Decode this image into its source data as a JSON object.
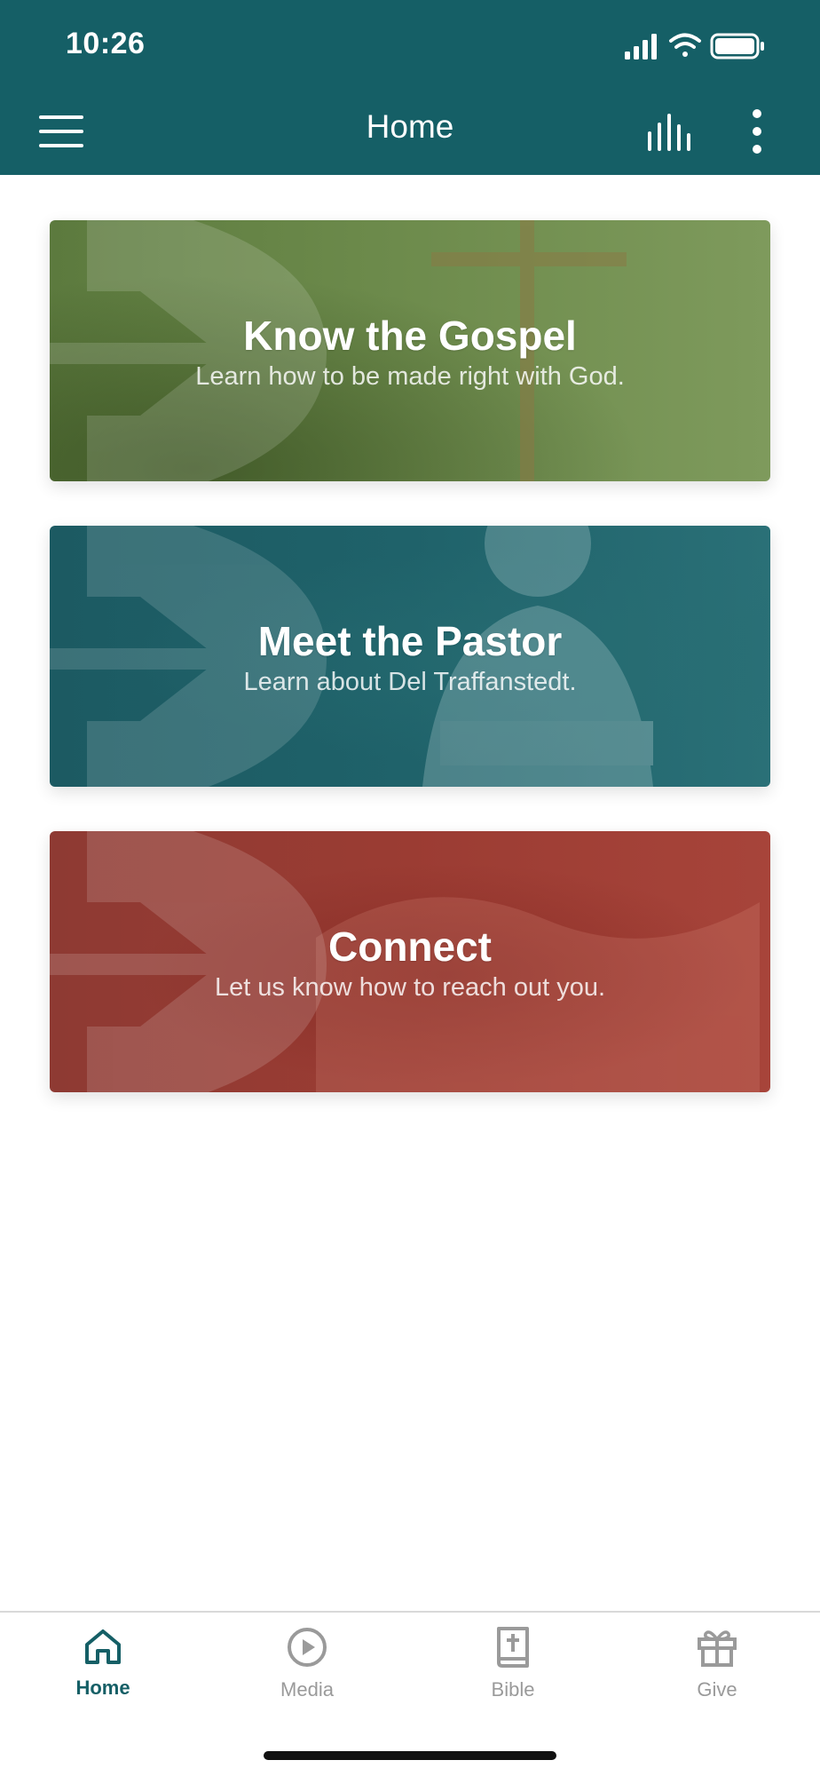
{
  "status_bar": {
    "time": "10:26"
  },
  "navbar": {
    "title": "Home",
    "menu_icon": "hamburger-menu-icon",
    "audio_icon": "equalizer-icon",
    "more_icon": "vertical-ellipsis-icon"
  },
  "cards": [
    {
      "title": "Know the Gospel",
      "subtitle": "Learn how to be made right with God."
    },
    {
      "title": "Meet the Pastor",
      "subtitle": "Learn about Del Traffanstedt."
    },
    {
      "title": "Connect",
      "subtitle": "Let us know how to reach out you."
    }
  ],
  "tabs": [
    {
      "label": "Home",
      "icon": "home-icon",
      "active": true
    },
    {
      "label": "Media",
      "icon": "play-circle-icon",
      "active": false
    },
    {
      "label": "Bible",
      "icon": "bible-icon",
      "active": false
    },
    {
      "label": "Give",
      "icon": "gift-icon",
      "active": false
    }
  ],
  "colors": {
    "header": "#155f66",
    "active_tab": "#155f66",
    "inactive_tab": "#9a9a9a",
    "card_gospel": "#6c8a4b",
    "card_pastor": "#1f626a",
    "card_connect": "#9b3c33"
  }
}
